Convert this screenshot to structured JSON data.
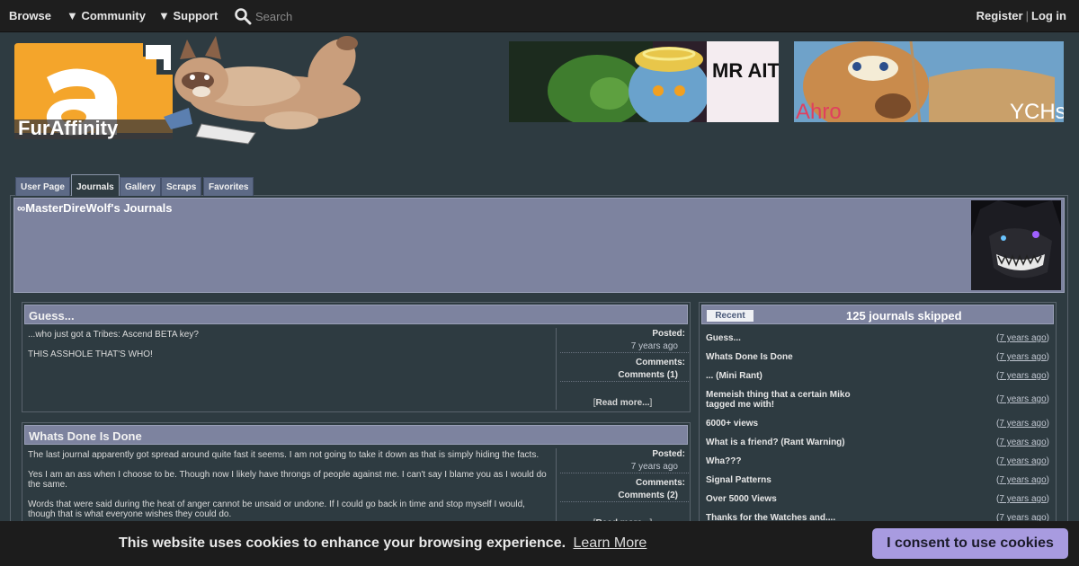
{
  "nav": {
    "browse": "Browse",
    "community": "▼ Community",
    "support": "▼ Support",
    "search_placeholder": "Search",
    "register": "Register",
    "separator": "|",
    "login": "Log in"
  },
  "logo": {
    "text": "FurAffinity"
  },
  "banners": [
    {
      "text": "MR AIT"
    },
    {
      "text_left": "Ahro",
      "text_right": "YCHs"
    }
  ],
  "tabs": [
    {
      "label": "User Page",
      "active": false
    },
    {
      "label": "Journals",
      "active": true
    },
    {
      "label": "Gallery",
      "active": false
    },
    {
      "label": "Scraps",
      "active": false
    },
    {
      "label": "Favorites",
      "active": false
    }
  ],
  "profile": {
    "title": "∞MasterDireWolf's Journals"
  },
  "journals": [
    {
      "title": "Guess...",
      "body": [
        "...who just got a Tribes: Ascend BETA key?",
        "THIS ASSHOLE THAT'S WHO!"
      ],
      "posted_label": "Posted:",
      "posted_value": "7 years ago",
      "comments_label": "Comments:",
      "comments_value": "Comments (1)",
      "read_more_open": "[",
      "read_more": "Read more...",
      "read_more_close": "]"
    },
    {
      "title": "Whats Done Is Done",
      "body": [
        "The last journal apparently got spread around quite fast it seems. I am not going to take it down as that is simply hiding the facts.",
        "Yes I am an ass when I choose to be. Though now I likely have throngs of people against me. I can't say I blame you as I would do the same.",
        "Words that were said during the heat of anger cannot be unsaid or undone. If I could go back in time and stop myself I would, though that is what everyone wishes they could do."
      ],
      "posted_label": "Posted:",
      "posted_value": "7 years ago",
      "comments_label": "Comments:",
      "comments_value": "Comments (2)",
      "read_more_open": "[",
      "read_more": "Read more...",
      "read_more_close": "]"
    }
  ],
  "sidebar": {
    "recent_tab": "Recent",
    "skipped": "125 journals skipped",
    "items": [
      {
        "title": "Guess...",
        "open": "(",
        "age": "7 years ago",
        "close": ")"
      },
      {
        "title": "Whats Done Is Done",
        "open": "(",
        "age": "7 years ago",
        "close": ")"
      },
      {
        "title": "... (Mini Rant)",
        "open": "(",
        "age": "7 years ago",
        "close": ")"
      },
      {
        "title": "Memeish thing that a certain Miko tagged me with!",
        "open": "(",
        "age": "7 years ago",
        "close": ")"
      },
      {
        "title": "6000+ views",
        "open": "(",
        "age": "7 years ago",
        "close": ")"
      },
      {
        "title": "What is a friend? (Rant Warning)",
        "open": "(",
        "age": "7 years ago",
        "close": ")"
      },
      {
        "title": "Wha???",
        "open": "(",
        "age": "7 years ago",
        "close": ")"
      },
      {
        "title": "Signal Patterns",
        "open": "(",
        "age": "7 years ago",
        "close": ")"
      },
      {
        "title": "Over 5000 Views",
        "open": "(",
        "age": "7 years ago",
        "close": ")"
      },
      {
        "title": "Thanks for the Watches and....",
        "open": "(",
        "age": "7 years ago",
        "close": ")"
      }
    ]
  },
  "cookie": {
    "message": "This website uses cookies to enhance your browsing experience.",
    "learn_more": "Learn More",
    "consent": "I consent to use cookies"
  },
  "colors": {
    "background": "#2e3b41",
    "topbar": "#1e1e1e",
    "header_bar": "#7d839f",
    "logo_orange": "#f4a52b",
    "consent_button": "#a89be0"
  }
}
